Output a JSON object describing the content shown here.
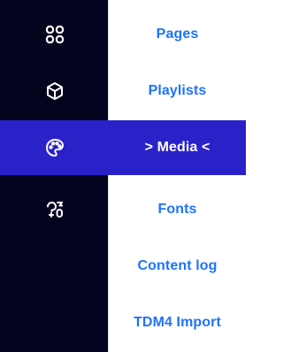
{
  "nav": {
    "items": [
      {
        "icon": "grid-icon",
        "label": "Pages"
      },
      {
        "icon": "cube-icon",
        "label": "Playlists"
      },
      {
        "icon": "palette-icon",
        "label": "> Media <"
      },
      {
        "icon": "fonts-icon",
        "label": "Fonts"
      },
      {
        "label": "Content log"
      },
      {
        "label": "TDM4 Import"
      }
    ],
    "active_index": 2
  },
  "colors": {
    "rail_background": "#05041f",
    "active_background": "#2a21c9",
    "label_color": "#1e73ff",
    "active_label_color": "#ffffff"
  }
}
